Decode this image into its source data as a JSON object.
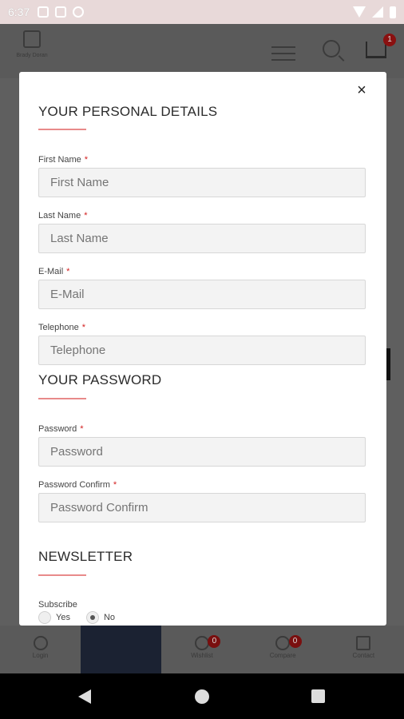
{
  "status": {
    "time": "6:37"
  },
  "header": {
    "logo_text": "Brady Doran",
    "cart_count": "1"
  },
  "modal": {
    "close": "×",
    "personal": {
      "title": "YOUR PERSONAL DETAILS",
      "first_name": {
        "label": "First Name",
        "placeholder": "First Name"
      },
      "last_name": {
        "label": "Last Name",
        "placeholder": "Last Name"
      },
      "email": {
        "label": "E-Mail",
        "placeholder": "E-Mail"
      },
      "telephone": {
        "label": "Telephone",
        "placeholder": "Telephone"
      }
    },
    "password": {
      "title": "YOUR PASSWORD",
      "password": {
        "label": "Password",
        "placeholder": "Password"
      },
      "confirm": {
        "label": "Password Confirm",
        "placeholder": "Password Confirm"
      }
    },
    "newsletter": {
      "title": "NEWSLETTER",
      "subscribe_label": "Subscribe",
      "yes": "Yes",
      "no": "No",
      "selected": "No"
    },
    "required_mark": "*"
  },
  "bottom_nav": {
    "login": "Login",
    "wishlist": "Wishlist",
    "wishlist_count": "0",
    "compare": "Compare",
    "compare_count": "0",
    "contact": "Contact"
  }
}
